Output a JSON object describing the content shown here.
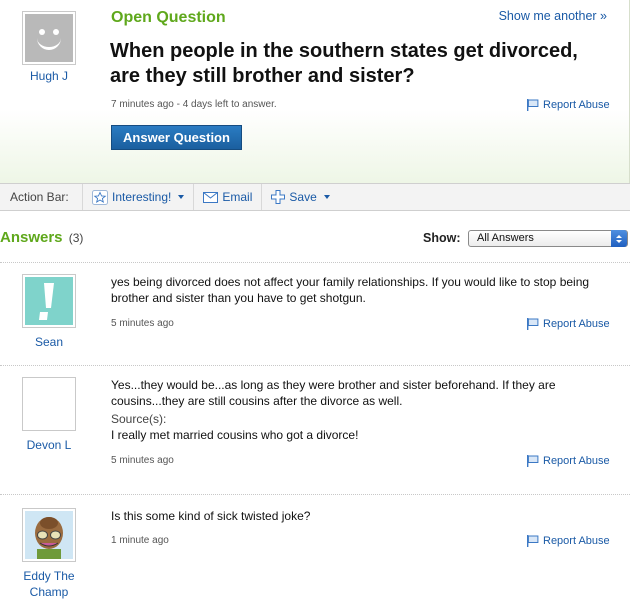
{
  "question": {
    "type_label": "Open Question",
    "show_another": "Show me another »",
    "title": "When people in the southern states get divorced, are they still brother and sister?",
    "meta": "7 minutes ago - 4 days left to answer.",
    "report_abuse": "Report Abuse",
    "answer_button": "Answer Question",
    "asker": {
      "name": "Hugh J",
      "avatar": "default-smiley-avatar"
    }
  },
  "action_bar": {
    "label": "Action Bar:",
    "interesting": "Interesting!",
    "email": "Email",
    "save": "Save"
  },
  "answers_header": {
    "title": "Answers",
    "count": "(3)",
    "show_label": "Show:",
    "show_selected": "All Answers"
  },
  "answers": [
    {
      "author": "Sean",
      "avatar": "exclamation-avatar",
      "text": "yes being divorced does not affect your family relationships. If you would like to stop being brother and sister than you have to get shotgun.",
      "time": "5 minutes ago",
      "report": "Report Abuse"
    },
    {
      "author": "Devon L",
      "avatar": "default-smiley-avatar",
      "text": "Yes...they would be...as long as they were brother and sister beforehand. If they are cousins...they are still cousins after the divorce as well.",
      "source_label": "Source(s):",
      "source": "I really met married cousins who got a divorce!",
      "time": "5 minutes ago",
      "report": "Report Abuse"
    },
    {
      "author": "Eddy The Champ",
      "avatar": "cartoon-character-avatar",
      "text": "Is this some kind of sick twisted joke?",
      "time": "1 minute ago",
      "report": "Report Abuse"
    }
  ],
  "colors": {
    "accent_green": "#5fa81c",
    "link_blue": "#1a5aa6",
    "button_blue": "#1b5f9f"
  }
}
